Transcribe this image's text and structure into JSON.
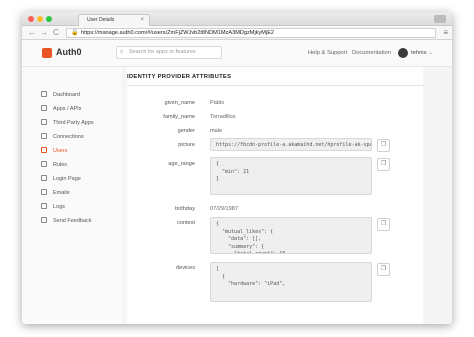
{
  "browser": {
    "tab_title": "User Details",
    "tab_close": "×",
    "url": "https://manage.auth0.com/#/users/ZmFjZWJvb2t8NDM1MzA3MDgzMjkyMjE2",
    "back_glyph": "←",
    "forward_glyph": "→",
    "reload_glyph": "C",
    "lock_glyph": "🔒",
    "menu_glyph": "≡"
  },
  "header": {
    "logo": "Auth0",
    "search_placeholder": "Search for apps or features",
    "search_icon_glyph": "⌕",
    "help_link": "Help & Support",
    "docs_link": "Documentation",
    "username": "tehnis",
    "username_caret": "⌄"
  },
  "sidebar": {
    "items": [
      {
        "label": "Dashboard",
        "icon": "dashboard-icon"
      },
      {
        "label": "Apps / APIs",
        "icon": "apps-icon"
      },
      {
        "label": "Third Party Apps",
        "icon": "third-party-icon"
      },
      {
        "label": "Connections",
        "icon": "connections-icon"
      },
      {
        "label": "Users",
        "icon": "users-icon",
        "active": true
      },
      {
        "label": "Rules",
        "icon": "rules-icon"
      },
      {
        "label": "Login Page",
        "icon": "login-page-icon"
      },
      {
        "label": "Emails",
        "icon": "emails-icon"
      },
      {
        "label": "Logs",
        "icon": "logs-icon"
      },
      {
        "label": "Send Feedback",
        "icon": "feedback-icon"
      }
    ]
  },
  "main": {
    "section_title": "IDENTITY PROVIDER ATTRIBUTES",
    "copy_glyph": "❐",
    "attributes": {
      "given_name": {
        "label": "given_name",
        "value": "Pablo"
      },
      "family_name": {
        "label": "family_name",
        "value": "Torradillos"
      },
      "gender": {
        "label": "gender",
        "value": "male"
      },
      "picture": {
        "label": "picture",
        "value": "https://fbcdn-profile-a.akamaihd.net/hprofile-ak-xpa"
      },
      "age_range": {
        "label": "age_range",
        "value": "{\n  \"min\": 21\n}"
      },
      "birthday": {
        "label": "birthday",
        "value": "07/29/1987"
      },
      "context": {
        "label": "context",
        "value": "{\n  \"mutual_likes\": {\n    \"data\": [],\n    \"summary\": {\n      \"total_count\": 10"
      },
      "devices": {
        "label": "devices",
        "value": "[\n  {\n    \"hardware\": \"iPad\","
      }
    }
  },
  "colors": {
    "accent": "#eb5424"
  }
}
